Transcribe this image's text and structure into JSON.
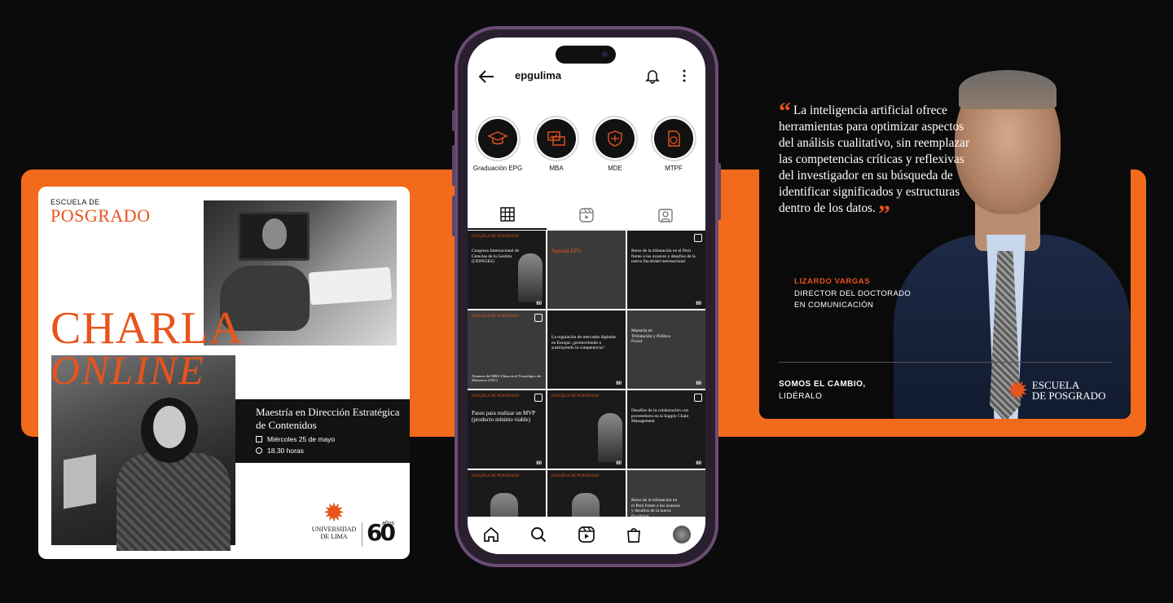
{
  "colors": {
    "accent": "#e8541c",
    "band": "#f26a1b",
    "background": "#0b0b0b"
  },
  "left_card": {
    "school_small": "ESCUELA DE",
    "school_big": "POSGRADO",
    "headline_1": "CHARLA",
    "headline_2": "ONLINE",
    "program": "Maestría en Dirección Estratégica de Contenidos",
    "date": "Miércoles 25 de mayo",
    "time": "18.30 horas",
    "university": "UNIVERSIDAD DE LIMA",
    "anniversary_number": "60",
    "anniversary_word": "años"
  },
  "phone": {
    "username": "epgulima",
    "highlights": [
      {
        "label": "Graduación EPG",
        "icon": "graduation-cap-icon"
      },
      {
        "label": "MBA",
        "icon": "chat-chart-icon"
      },
      {
        "label": "MDE",
        "icon": "shield-scale-icon"
      },
      {
        "label": "MTPF",
        "icon": "tax-document-icon"
      }
    ],
    "tabs": [
      {
        "icon": "grid-icon",
        "active": true
      },
      {
        "icon": "reels-icon",
        "active": false
      },
      {
        "icon": "tagged-icon",
        "active": false
      }
    ],
    "posts": [
      {
        "header": "ESCUELA DE POSGRADO",
        "title": "Congreso Internacional de Ciencias de la Gestión (UDINGES)"
      },
      {
        "header": "",
        "title": "Agenda EPG"
      },
      {
        "header": "",
        "title": "Retos de la tributación en el Perú frente a los avances y desafíos de la nueva fiscalidad internacional"
      },
      {
        "header": "ESCUELA DE POSGRADO",
        "title": "Alumnos del MBA Ulima en el Tecnológico de Monterrey (TEC)"
      },
      {
        "header": "",
        "title": "La regulación de mercados digitales en Europa: ¿promoviendo o sustituyendo la competencia?"
      },
      {
        "header": "",
        "title": "Maestría en Tributación y Política Fiscal"
      },
      {
        "header": "ESCUELA DE POSGRADO",
        "title": "Pasos para realizar un MVP (producto mínimo viable)"
      },
      {
        "header": "ESCUELA DE POSGRADO",
        "title": ""
      },
      {
        "header": "",
        "title": "Desafíos de la colaboración con proveedores en la Supply Chain Management"
      },
      {
        "header": "ESCUELA DE POSGRADO",
        "title": ""
      },
      {
        "header": "ESCUELA DE POSGRADO",
        "title": ""
      },
      {
        "header": "",
        "title": "Retos de la tributación en el Perú frente a los avances y desafíos de la nueva fiscalidad"
      }
    ],
    "sixty_badge": "60",
    "nav": [
      "home-icon",
      "search-icon",
      "reels-icon",
      "shop-icon",
      "profile-avatar"
    ]
  },
  "right_card": {
    "quote": "La inteligencia artificial ofrece herramientas para optimizar aspectos del análisis cualitativo, sin reemplazar las competencias críticas y reflexivas del investigador en su búsqueda de identificar significados y estructuras dentro de los datos.",
    "open_quote": "“",
    "close_quote": "”",
    "name": "LIZARDO VARGAS",
    "role": "DIRECTOR DEL DOCTORADO EN COMUNICACIÓN",
    "tagline_1": "SOMOS EL CAMBIO,",
    "tagline_2": "LIDÉRALO",
    "logo_line_1": "ESCUELA",
    "logo_line_2": "DE POSGRADO"
  }
}
